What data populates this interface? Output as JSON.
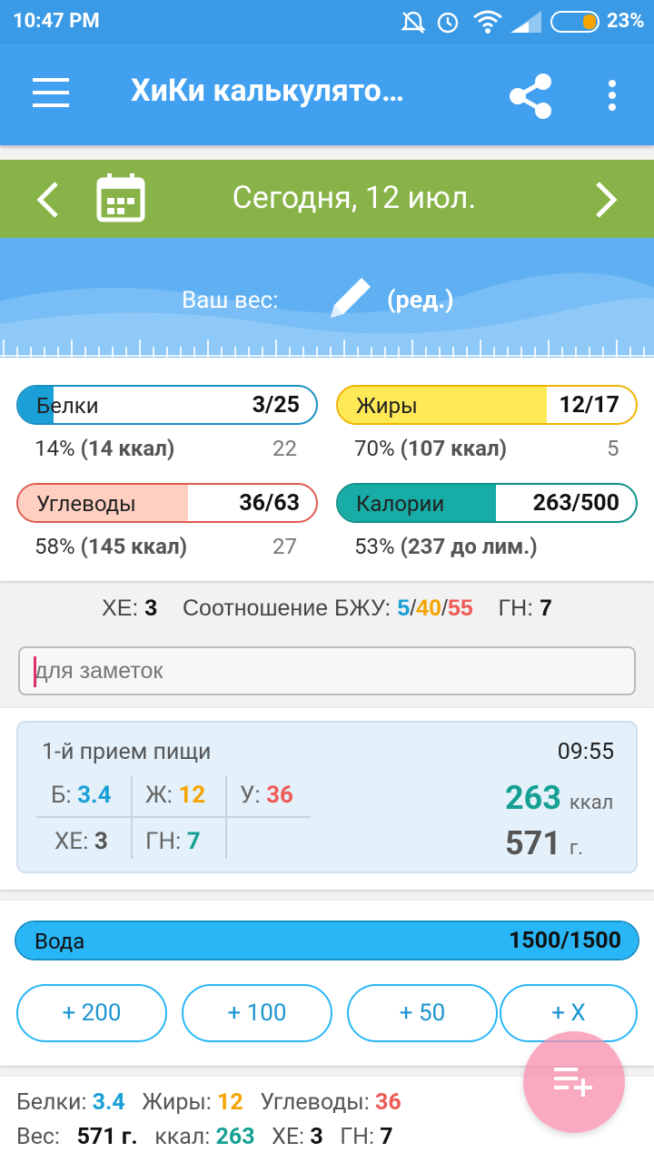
{
  "status": {
    "time": "10:47 PM",
    "battery": "23%"
  },
  "appbar": {
    "title": "ХиКи калькулято…"
  },
  "date_bar": {
    "label": "Сегодня, 12 июл."
  },
  "weight": {
    "label": "Ваш вес:",
    "edit": "(ред.)"
  },
  "macros": {
    "protein": {
      "label": "Белки",
      "value": "3/25",
      "pct": "14%",
      "kcal": "(14 ккал)",
      "remaining": "22",
      "fill": 0.12
    },
    "fat": {
      "label": "Жиры",
      "value": "12/17",
      "pct": "70%",
      "kcal": "(107 ккал)",
      "remaining": "5",
      "fill": 0.7
    },
    "carbs": {
      "label": "Углеводы",
      "value": "36/63",
      "pct": "58%",
      "kcal": "(145 ккал)",
      "remaining": "27",
      "fill": 0.57
    },
    "calories": {
      "label": "Калории",
      "value": "263/500",
      "pct": "53%",
      "kcal": "(237 до лим.)",
      "fill": 0.53
    }
  },
  "summary": {
    "xe_label": "ХЕ:",
    "xe": "3",
    "ratio_label": "Соотношение БЖУ:",
    "r_p": "5",
    "r_f": "40",
    "r_c": "55",
    "sep": "/",
    "gn_label": "ГН:",
    "gn": "7"
  },
  "notes": {
    "placeholder": "для заметок"
  },
  "meal": {
    "title": "1-й прием пищи",
    "time": "09:55",
    "p_label": "Б:",
    "p": "3.4",
    "f_label": "Ж:",
    "f": "12",
    "c_label": "У:",
    "c": "36",
    "xe_label": "ХЕ:",
    "xe": "3",
    "gn_label": "ГН:",
    "gn": "7",
    "kcal": "263",
    "kcal_unit": "ккал",
    "grams": "571",
    "grams_unit": "г."
  },
  "water": {
    "label": "Вода",
    "value": "1500/1500",
    "fill": 1.0,
    "buttons": [
      "+ 200",
      "+ 100",
      "+ 50",
      "+ X"
    ]
  },
  "totals": {
    "p_label": "Белки:",
    "p": "3.4",
    "f_label": "Жиры:",
    "f": "12",
    "c_label": "Углеводы:",
    "c": "36",
    "w_label": "Вес:",
    "w": "571 г.",
    "k_label": "ккал:",
    "k": "263",
    "xe_label": "ХЕ:",
    "xe": "3",
    "gn_label": "ГН:",
    "gn": "7"
  },
  "colors": {
    "appbar": "#42a0f0",
    "date": "#88b348",
    "protein": "#1aa0d6",
    "fat": "#ffe957",
    "carbs": "#ffd0c1",
    "calories": "#17aca5",
    "water": "#29b6f6"
  }
}
